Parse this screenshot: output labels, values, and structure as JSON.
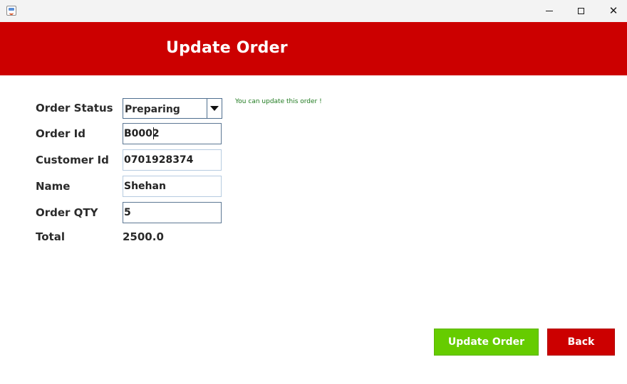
{
  "window": {
    "icon": "java-cup-icon",
    "controls": [
      "minimize-icon",
      "maximize-icon",
      "close-icon"
    ],
    "close_glyph": "✕"
  },
  "header": {
    "title": "Update Order",
    "background": "#cc0000"
  },
  "form": {
    "status_label": "Order Status",
    "status_value": "Preparing",
    "order_id_label": "Order Id",
    "order_id_value": "B0002",
    "customer_id_label": "Customer Id",
    "customer_id_value": "0701928374",
    "name_label": "Name",
    "name_value": "Shehan",
    "qty_label": "Order QTY",
    "qty_value": "5",
    "total_label": "Total",
    "total_value": "2500.0"
  },
  "hint": {
    "text": "You can update this order !",
    "color": "#1f7a1f"
  },
  "buttons": {
    "update_label": "Update Order",
    "update_color": "#66cc00",
    "back_label": "Back",
    "back_color": "#cc0000"
  }
}
